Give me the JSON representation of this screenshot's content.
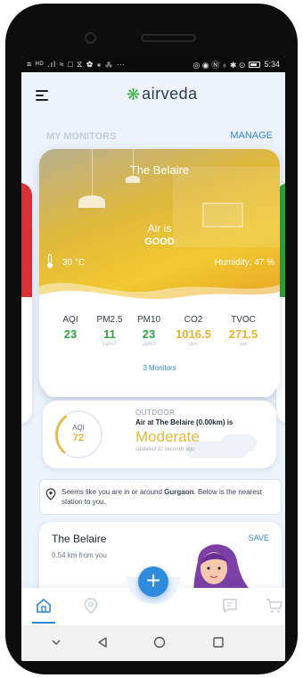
{
  "status_bar": {
    "left": "≡ ᴴᴰ .ıl ≈ □ ⧖ ✿ ⁕ ⁂ ⋯",
    "right_icons": "◎ ◉ Ⓝ ♁ ✱ ⊙",
    "time": "5:34"
  },
  "header": {
    "logo_text": "airveda",
    "logo_icon": "leaf-asterisk-icon",
    "menu_icon": "hamburger-icon"
  },
  "section": {
    "title": "MY MONITORS",
    "manage_label": "MANAGE"
  },
  "monitor": {
    "name": "The Belaire",
    "air_is": "Air is",
    "status": "GOOD",
    "temperature": "30 °C",
    "humidity": "Humidity: 47 %",
    "metrics": [
      {
        "label": "AQI",
        "value": "23",
        "unit": "",
        "color": "#2fa443"
      },
      {
        "label": "PM2.5",
        "value": "11",
        "unit": "µg/m3",
        "color": "#2fa443"
      },
      {
        "label": "PM10",
        "value": "23",
        "unit": "µg/m3",
        "color": "#2fa443"
      },
      {
        "label": "CO2",
        "value": "1016.5",
        "unit": "ppm",
        "color": "#e0b331"
      },
      {
        "label": "TVOC",
        "value": "271.5",
        "unit": "ppb",
        "color": "#e0b331"
      }
    ],
    "monitors_link": "3 Monitors",
    "hero_color": "#f1c932"
  },
  "outdoor": {
    "aqi_label": "AQI",
    "aqi_value": "72",
    "tag": "OUTDOOR",
    "line": "Air at The Belaire (0.00km) is",
    "status": "Moderate",
    "updated": "Updated 32 seconds ago",
    "status_color": "#e5b837"
  },
  "notice": {
    "text_before": "Seems like you are in or around ",
    "city": "Gurgaon",
    "text_after": ". Below is the nearest station to you."
  },
  "station": {
    "name": "The Belaire",
    "distance": "0.54 km from you",
    "save_label": "SAVE"
  },
  "bottom_nav": {
    "items": [
      "home-icon",
      "location-pin-icon",
      "add-icon",
      "chat-icon",
      "cart-icon"
    ],
    "fab_label": "+",
    "accent": "#2f86d1"
  },
  "system_nav": [
    "back-chevron-icon",
    "back-triangle-icon",
    "home-circle-icon",
    "recents-square-icon"
  ]
}
